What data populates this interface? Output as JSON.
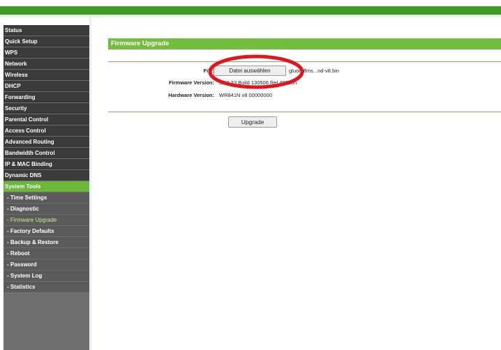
{
  "sidebar": {
    "items": [
      {
        "label": "Status"
      },
      {
        "label": "Quick Setup"
      },
      {
        "label": "WPS"
      },
      {
        "label": "Network"
      },
      {
        "label": "Wireless"
      },
      {
        "label": "DHCP"
      },
      {
        "label": "Forwarding"
      },
      {
        "label": "Security"
      },
      {
        "label": "Parental Control"
      },
      {
        "label": "Access Control"
      },
      {
        "label": "Advanced Routing"
      },
      {
        "label": "Bandwidth Control"
      },
      {
        "label": "IP & MAC Binding"
      },
      {
        "label": "Dynamic DNS"
      },
      {
        "label": "System Tools"
      }
    ],
    "subitems": [
      {
        "label": "- Time Settings"
      },
      {
        "label": "- Diagnostic"
      },
      {
        "label": "- Firmware Upgrade"
      },
      {
        "label": "- Factory Defaults"
      },
      {
        "label": "- Backup & Restore"
      },
      {
        "label": "- Reboot"
      },
      {
        "label": "- Password"
      },
      {
        "label": "- System Log"
      },
      {
        "label": "- Statistics"
      }
    ]
  },
  "main": {
    "title": "Firmware Upgrade",
    "file_label": "File:",
    "file_button": "Datei auswählen",
    "file_name": "gluon-ffms...nd-v8.bin",
    "firmware_label": "Firmware Version:",
    "firmware_value": "3.13.33 Build 130506 Rel.48660n",
    "hardware_label": "Hardware Version:",
    "hardware_value": "WR841N v8 00000000",
    "upgrade_button": "Upgrade"
  },
  "colors": {
    "brand_green": "#3f9a23",
    "header_green": "#73be3e",
    "active_menu": "#6bb73b",
    "annotation_red": "#e0161f"
  }
}
